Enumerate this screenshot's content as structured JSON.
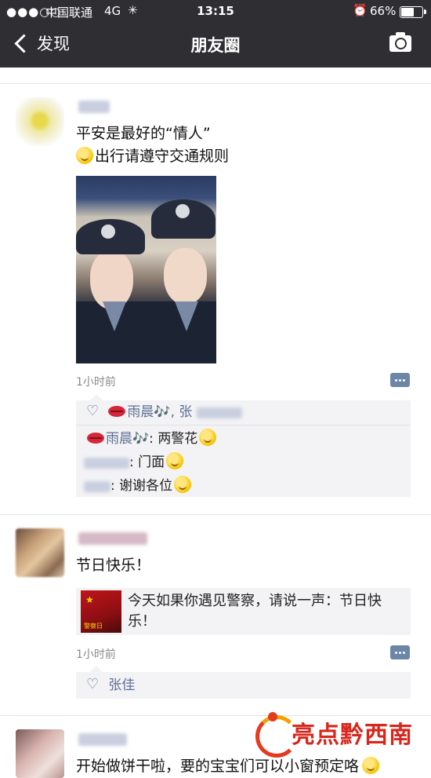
{
  "status_bar": {
    "signal": "●●●○○",
    "carrier": "中国联通",
    "network": "4G",
    "time": "13:15",
    "battery_percent": "66%",
    "battery_level": 0.66
  },
  "nav": {
    "back_label": "发现",
    "title": "朋友圈"
  },
  "posts": [
    {
      "text_line1": "平安是最好的“情人”",
      "text_line2": "出行请遵守交通规则",
      "time": "1小时前",
      "likes_names": "雨晨🎶, 张",
      "likes_sep": ", ",
      "comments": [
        {
          "author": "雨晨🎶",
          "sep": ": ",
          "text": "两警花"
        },
        {
          "author": "",
          "sep": ": ",
          "text": "门面"
        },
        {
          "author": "",
          "sep": ": ",
          "text": "谢谢各位"
        }
      ]
    },
    {
      "text": "节日快乐！",
      "link_text": "今天如果你遇见警察，请说一声：节日快乐！",
      "link_thumb_caption": "警察日",
      "time": "1小时前",
      "likes_names": "张佳"
    },
    {
      "text": "开始做饼干啦，要的宝宝们可以小窗预定咯"
    }
  ],
  "watermark": {
    "text": "亮点黔西南"
  },
  "colors": {
    "nav_bg": "#2e2e33",
    "name_link": "#5c6f95",
    "comment_bg": "#f3f3f5",
    "watermark_red": "#d9261c"
  }
}
